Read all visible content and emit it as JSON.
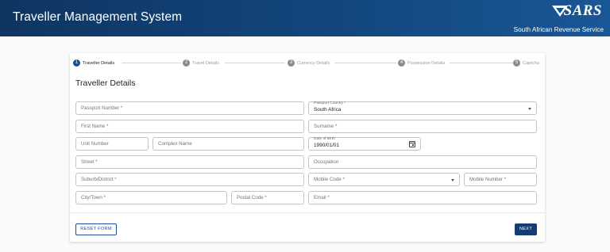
{
  "app": {
    "title": "Traveller Management System",
    "logo_text": "SARS",
    "logo_subtitle": "South African Revenue Service"
  },
  "stepper": {
    "steps": [
      {
        "number": "1",
        "label": "Traveller Details",
        "active": true
      },
      {
        "number": "2",
        "label": "Travel Details",
        "active": false
      },
      {
        "number": "3",
        "label": "Currency Details",
        "active": false
      },
      {
        "number": "4",
        "label": "Possession Details",
        "active": false
      },
      {
        "number": "5",
        "label": "Captcha",
        "active": false
      }
    ]
  },
  "form": {
    "title": "Traveller Details",
    "passport_number": {
      "placeholder": "Passport Number *"
    },
    "passport_country": {
      "label": "Passport Country *",
      "value": "South Africa"
    },
    "first_name": {
      "placeholder": "First Name *"
    },
    "surname": {
      "placeholder": "Surname *"
    },
    "unit_number": {
      "placeholder": "Unit Number"
    },
    "complex_name": {
      "placeholder": "Complex Name"
    },
    "date_of_birth": {
      "label": "Date of Birth",
      "value": "1990/01/01"
    },
    "street": {
      "placeholder": "Street *"
    },
    "occupation": {
      "placeholder": "Occupation"
    },
    "suburb_district": {
      "placeholder": "Suburb/District *"
    },
    "mobile_code": {
      "placeholder": "Mobile Code *"
    },
    "mobile_number": {
      "placeholder": "Mobile Number *"
    },
    "city_town": {
      "placeholder": "City/Town *"
    },
    "postal_code": {
      "placeholder": "Postal Code *"
    },
    "email": {
      "placeholder": "Email *"
    }
  },
  "actions": {
    "reset_label": "RESET FORM",
    "next_label": "NEXT"
  },
  "colors": {
    "header_start": "#0f3561",
    "header_end": "#1a5796",
    "primary": "#1f4e8c",
    "next_button": "#123e73"
  }
}
